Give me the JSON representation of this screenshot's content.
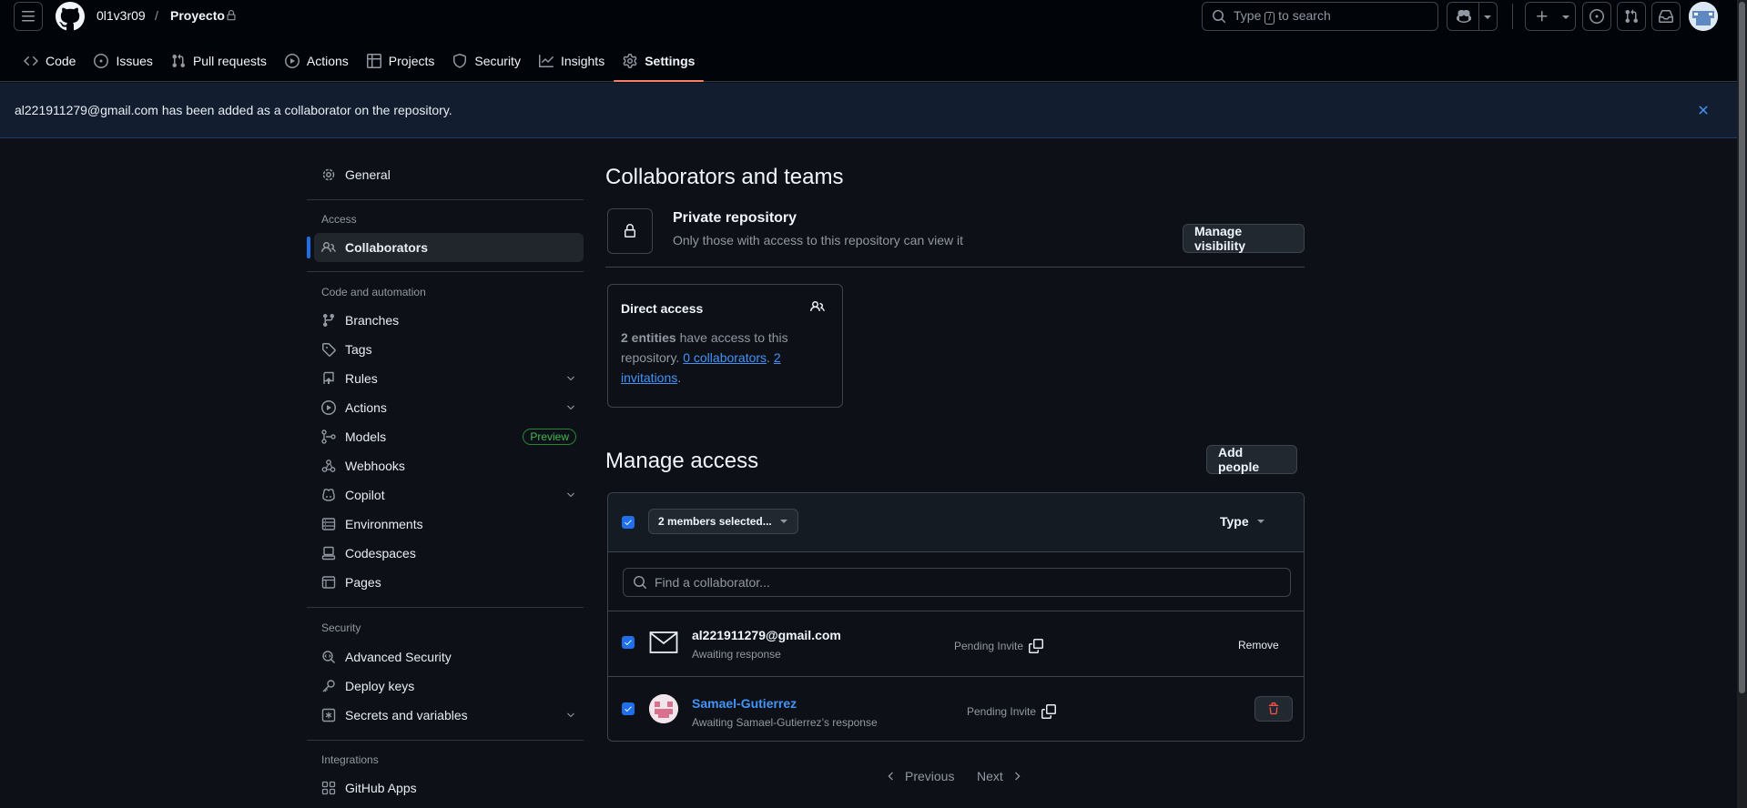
{
  "header": {
    "owner": "0l1v3r09",
    "separator": "/",
    "repo": "Proyecto",
    "search_prefix": "Type",
    "search_key": "/",
    "search_suffix": "to search"
  },
  "tabs": [
    {
      "label": "Code"
    },
    {
      "label": "Issues"
    },
    {
      "label": "Pull requests"
    },
    {
      "label": "Actions"
    },
    {
      "label": "Projects"
    },
    {
      "label": "Security"
    },
    {
      "label": "Insights"
    },
    {
      "label": "Settings"
    }
  ],
  "flash": {
    "message": "al221911279@gmail.com has been added as a collaborator on the repository."
  },
  "sidebar": {
    "general": "General",
    "access_heading": "Access",
    "collaborators": "Collaborators",
    "code_heading": "Code and automation",
    "branches": "Branches",
    "tags": "Tags",
    "rules": "Rules",
    "actions": "Actions",
    "models": "Models",
    "preview_badge": "Preview",
    "webhooks": "Webhooks",
    "copilot": "Copilot",
    "environments": "Environments",
    "codespaces": "Codespaces",
    "pages": "Pages",
    "security_heading": "Security",
    "advanced_security": "Advanced Security",
    "deploy_keys": "Deploy keys",
    "secrets": "Secrets and variables",
    "integrations_heading": "Integrations",
    "github_apps": "GitHub Apps"
  },
  "main": {
    "title": "Collaborators and teams",
    "private_title": "Private repository",
    "private_desc": "Only those with access to this repository can view it",
    "manage_visibility": "Manage visibility",
    "direct_access": {
      "title": "Direct access",
      "entities": "2 entities",
      "text1": " have access to this repository. ",
      "collaborators_link": "0 collaborators",
      "dot": ". ",
      "invitations_link": "2 invitations",
      "end": "."
    },
    "manage_access_title": "Manage access",
    "add_people": "Add people",
    "members_selected": "2 members selected...",
    "type_filter": "Type",
    "find_placeholder": "Find a collaborator...",
    "rows": [
      {
        "name": "al221911279@gmail.com",
        "sub": "Awaiting response",
        "status": "Pending Invite",
        "action": "Remove"
      },
      {
        "name": "Samael-Gutierrez",
        "sub": "Awaiting Samael-Gutierrez’s response",
        "status": "Pending Invite"
      }
    ],
    "pagination": {
      "previous": "Previous",
      "next": "Next"
    }
  },
  "colors": {
    "accent": "#1f6feb",
    "link": "#4493f8",
    "danger": "#f85149",
    "background": "#0d1117"
  }
}
